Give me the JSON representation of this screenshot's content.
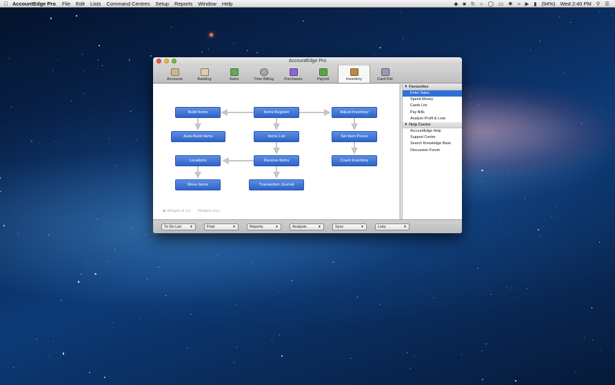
{
  "menubar": {
    "app_name": "AccountEdge Pro",
    "menus": [
      "File",
      "Edit",
      "Lists",
      "Command Centres",
      "Setup",
      "Reports",
      "Window",
      "Help"
    ],
    "battery": "(94%)",
    "clock": "Wed 2:40 PM",
    "status_icons": [
      "dropbox-icon",
      "truck-icon",
      "time-machine-icon",
      "chat-icon",
      "sync-icon",
      "display-icon",
      "bluetooth-icon",
      "wifi-icon",
      "volume-icon",
      "battery-icon"
    ]
  },
  "window": {
    "title": "AccountEdge Pro",
    "tabs": [
      {
        "label": "Accounts",
        "icon": "accounts-icon",
        "color": "#c9b98a"
      },
      {
        "label": "Banking",
        "icon": "banking-icon",
        "color": "#b9a98a"
      },
      {
        "label": "Sales",
        "icon": "sales-icon",
        "color": "#6aa55a"
      },
      {
        "label": "Time Billing",
        "icon": "time-billing-icon",
        "color": "#9a9a9a"
      },
      {
        "label": "Purchases",
        "icon": "purchases-icon",
        "color": "#8a6ac8"
      },
      {
        "label": "Payroll",
        "icon": "payroll-icon",
        "color": "#58a848"
      },
      {
        "label": "Inventory",
        "icon": "inventory-icon",
        "color": "#b88a4a"
      },
      {
        "label": "Card File",
        "icon": "card-file-icon",
        "color": "#8a8aa0"
      }
    ],
    "active_tab": "Inventory",
    "flow_buttons": {
      "build_items": "Build Items",
      "items_register": "Items Register",
      "adjust_inventory": "Adjust Inventory",
      "auto_build_items": "Auto-Build Items",
      "items_list": "Items List",
      "set_item_prices": "Set Item Prices",
      "locations": "Locations",
      "receive_items": "Receive Items",
      "count_inventory": "Count Inventory",
      "move_items": "Move Items",
      "transaction_journal": "Transaction Journal"
    },
    "company_name": "Widgets & Co.",
    "file_name": "Widgets.myo",
    "sidebar": {
      "favourites_header": "Favourites",
      "favourites": [
        "Enter Sales",
        "Spend Money",
        "Cards List",
        "Pay Bills",
        "Analyze Profit & Loss"
      ],
      "help_header": "Help Centre",
      "help": [
        "AccountEdge Help",
        "Support Centre",
        "Search Knowledge Base",
        "Discussion Forum"
      ]
    },
    "bottom_dropdowns": [
      "To Do List",
      "Find",
      "Reports",
      "Analysis",
      "Sync",
      "Lists"
    ]
  }
}
